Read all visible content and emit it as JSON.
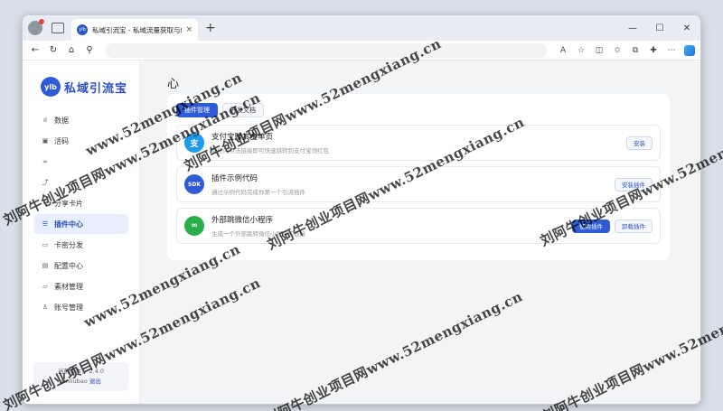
{
  "browser": {
    "tab_title": "私域引流宝 - 私域流量获取与绿色...",
    "tab_favicon": "ylb",
    "tab_close": "×",
    "new_tab": "+",
    "address_placeholder": "",
    "win_minimize": "—",
    "win_maximize": "☐",
    "win_close": "✕"
  },
  "app": {
    "logo_mark": "ylb",
    "logo_name": "私域引流宝",
    "menu": [
      {
        "label": "数据",
        "icon": "chart-icon"
      },
      {
        "label": "活码",
        "icon": "qrcode-icon"
      },
      {
        "label": "",
        "icon": "link-icon"
      },
      {
        "label": "",
        "icon": "shortlink-icon"
      },
      {
        "label": "分享卡片",
        "icon": "share-icon"
      },
      {
        "label": "插件中心",
        "icon": "plugin-icon",
        "active": true
      },
      {
        "label": "卡密分发",
        "icon": "card-icon"
      },
      {
        "label": "配置中心",
        "icon": "config-icon"
      },
      {
        "label": "素材管理",
        "icon": "folder-icon"
      },
      {
        "label": "账号管理",
        "icon": "user-icon"
      }
    ],
    "version_label": "当前版本： 2.4.0",
    "username": "yinliubao",
    "logout_label": "退出"
  },
  "main": {
    "page_title": "心",
    "tabs": [
      {
        "label": "插件管理",
        "active": true
      },
      {
        "label": "开发文档",
        "active": false
      }
    ],
    "plugins": [
      {
        "name": "支付宝赚赏金单页",
        "desc": "微信内点击链接即可快速跳转到支付宝领红包",
        "icon_text": "支",
        "icon_color": "#1e9be8",
        "actions": [
          {
            "label": "安装",
            "primary": false
          }
        ]
      },
      {
        "name": "插件示例代码",
        "desc": "通过示例代码完成你第一个引流插件",
        "icon_text": "SDK",
        "icon_color": "#2f5bd6",
        "actions": [
          {
            "label": "安装插件",
            "primary": false
          }
        ]
      },
      {
        "name": "外部跳微信小程序",
        "desc": "生成一个外部跳转微信小程序的链接",
        "icon_text": "∞",
        "icon_color": "#2aae4a",
        "actions": [
          {
            "label": "使用插件",
            "primary": true
          },
          {
            "label": "卸载插件",
            "primary": false
          }
        ]
      }
    ]
  },
  "watermark": {
    "text_cn": "刘阿牛创业项目网www.52mengxiang.cn",
    "text_url": "www.52mengxiang.cn"
  },
  "colors": {
    "accent": "#2f5bd6",
    "sidebar_active_bg": "#e8eefc",
    "main_bg": "#f3f4f6"
  }
}
